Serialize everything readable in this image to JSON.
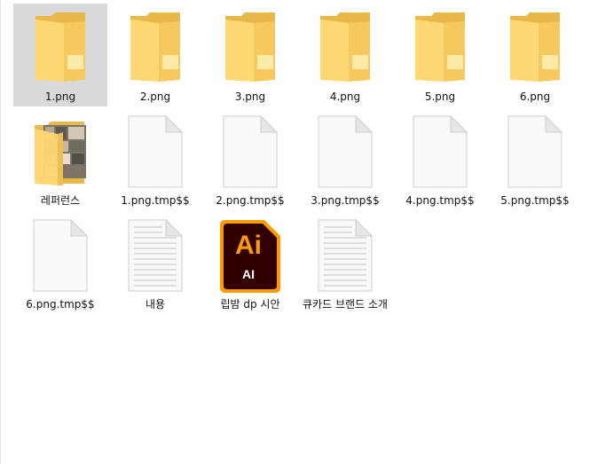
{
  "explorer": {
    "items": [
      {
        "label": "1.png",
        "kind": "folder",
        "selected": true
      },
      {
        "label": "2.png",
        "kind": "folder"
      },
      {
        "label": "3.png",
        "kind": "folder"
      },
      {
        "label": "4.png",
        "kind": "folder"
      },
      {
        "label": "5.png",
        "kind": "folder"
      },
      {
        "label": "6.png",
        "kind": "folder"
      },
      {
        "label": "레퍼런스",
        "kind": "folder-with-images"
      },
      {
        "label": "1.png.tmp$$",
        "kind": "blank-file"
      },
      {
        "label": "2.png.tmp$$",
        "kind": "blank-file"
      },
      {
        "label": "3.png.tmp$$",
        "kind": "blank-file"
      },
      {
        "label": "4.png.tmp$$",
        "kind": "blank-file"
      },
      {
        "label": "5.png.tmp$$",
        "kind": "blank-file"
      },
      {
        "label": "6.png.tmp$$",
        "kind": "blank-file"
      },
      {
        "label": "내용",
        "kind": "text-file"
      },
      {
        "label": "립밤 dp 시안",
        "kind": "illustrator-file",
        "icon_text": "Ai",
        "icon_subtext": "AI"
      },
      {
        "label": "큐카드 브랜드 소개",
        "kind": "text-file"
      }
    ]
  },
  "colors": {
    "folder_back": "#e8b84a",
    "folder_front": "#ffd874",
    "selection": "#d9d9d9",
    "ai_bg": "#300000",
    "ai_border": "#ff9a00",
    "ai_text": "#ff9a00"
  }
}
